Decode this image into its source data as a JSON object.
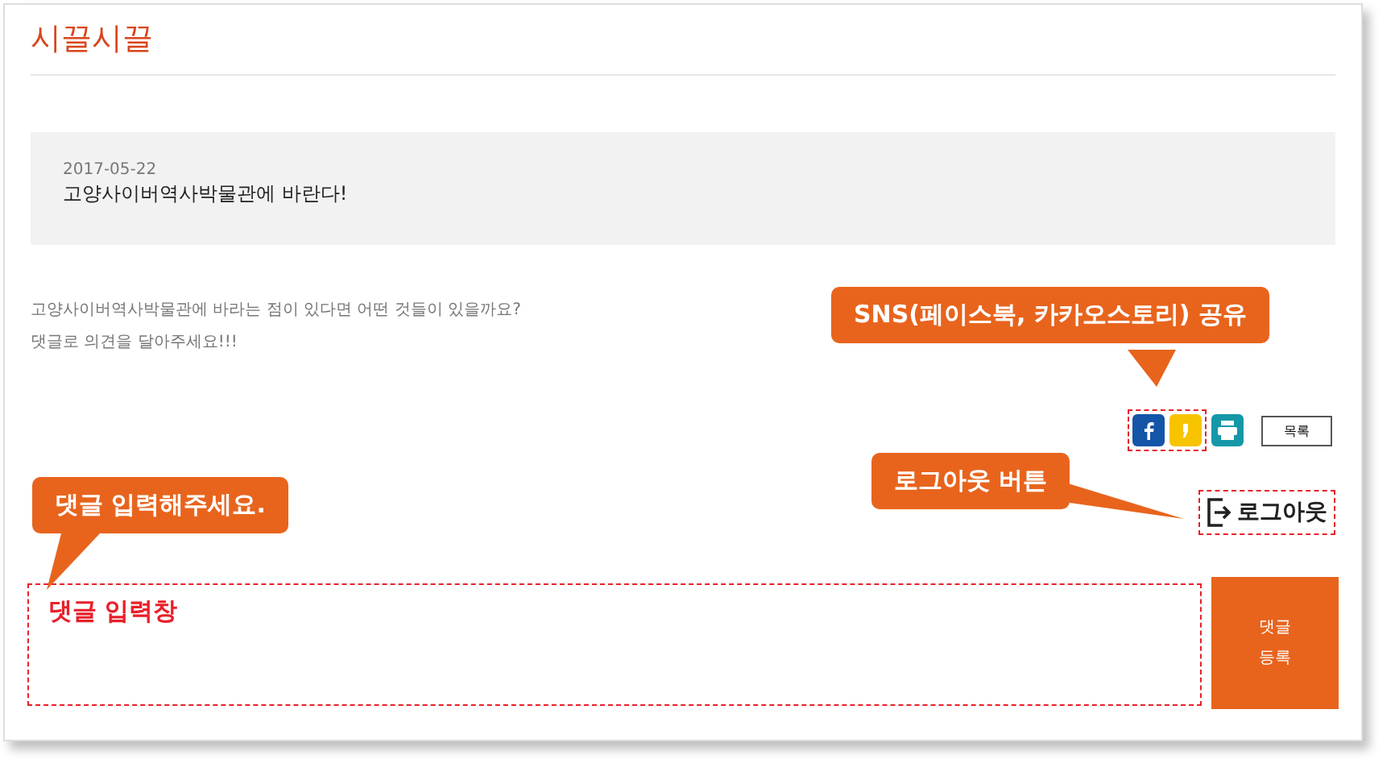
{
  "page": {
    "title": "시끌시끌"
  },
  "post": {
    "date": "2017-05-22",
    "title": "고양사이버역사박물관에 바란다!",
    "body": [
      "고양사이버역사박물관에 바라는 점이 있다면 어떤 것들이 있을까요?",
      "댓글로 의견을 달아주세요!!!"
    ]
  },
  "share_buttons": [
    {
      "kind": "facebook"
    },
    {
      "kind": "kakaostory"
    },
    {
      "kind": "print"
    }
  ],
  "list_button": "목록",
  "logout_button": "로그아웃",
  "comment": {
    "annotation": "댓글 입력창",
    "submit_lines": [
      "댓글",
      "등록"
    ]
  },
  "callouts": [
    {
      "text": "SNS(페이스북, 카카오스토리) 공유"
    },
    {
      "text": "로그아웃 버튼"
    },
    {
      "text": "댓글 입력해주세요."
    }
  ]
}
